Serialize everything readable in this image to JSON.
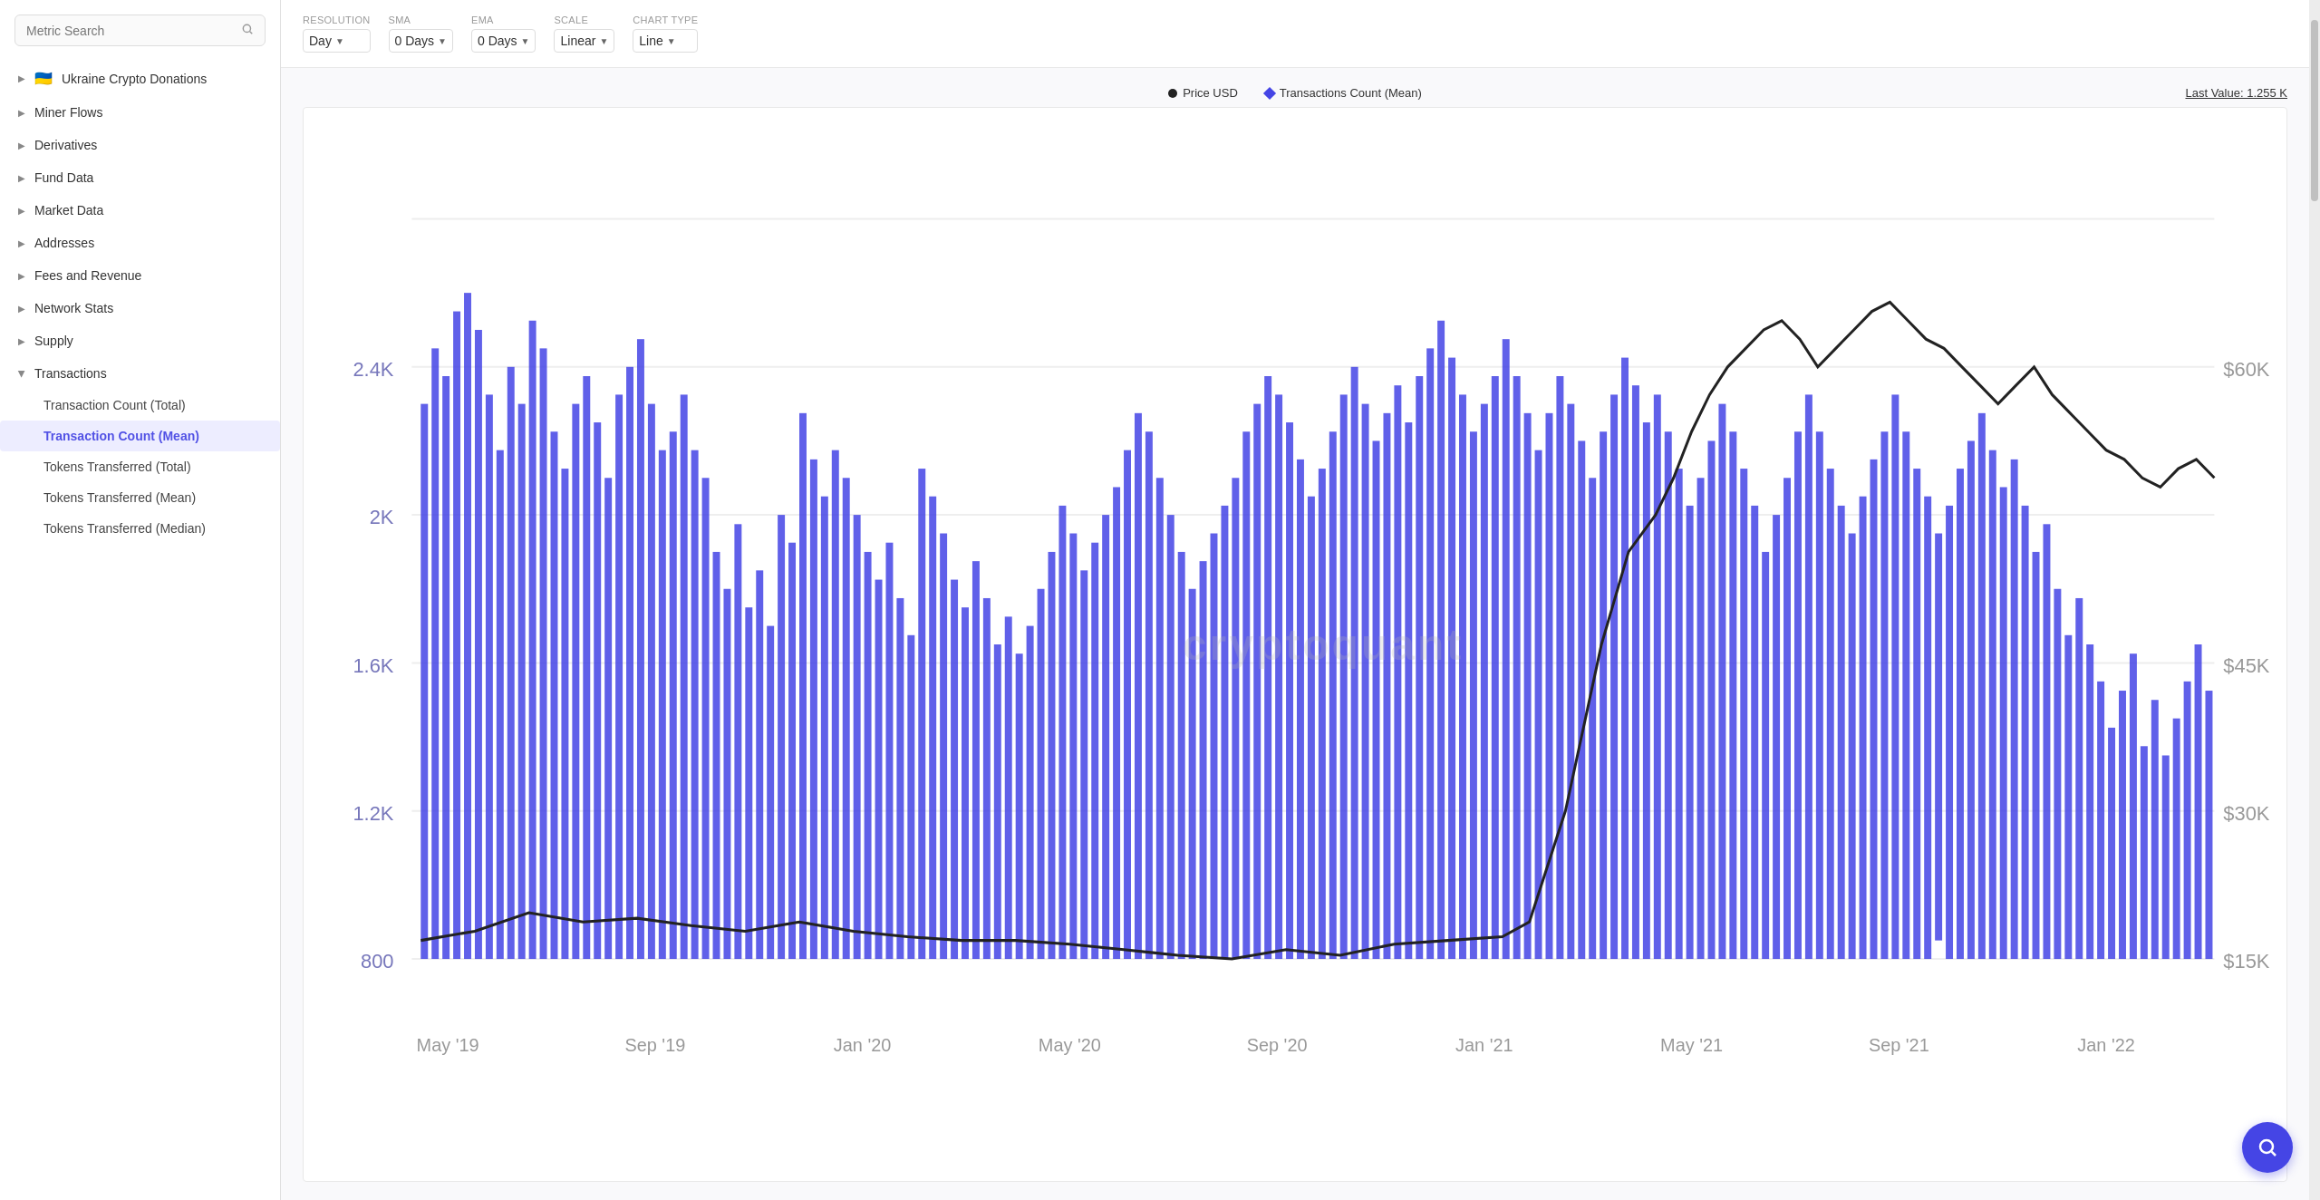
{
  "sidebar": {
    "search_placeholder": "Metric Search",
    "items": [
      {
        "id": "ukraine",
        "label": "Ukraine Crypto Donations",
        "flag": "🇺🇦",
        "expanded": false
      },
      {
        "id": "miner-flows",
        "label": "Miner Flows",
        "expanded": false
      },
      {
        "id": "derivatives",
        "label": "Derivatives",
        "expanded": false
      },
      {
        "id": "fund-data",
        "label": "Fund Data",
        "expanded": false
      },
      {
        "id": "market-data",
        "label": "Market Data",
        "expanded": false
      },
      {
        "id": "addresses",
        "label": "Addresses",
        "expanded": false
      },
      {
        "id": "fees-revenue",
        "label": "Fees and Revenue",
        "expanded": false
      },
      {
        "id": "network-stats",
        "label": "Network Stats",
        "expanded": false
      },
      {
        "id": "supply",
        "label": "Supply",
        "expanded": false
      },
      {
        "id": "transactions",
        "label": "Transactions",
        "expanded": true
      }
    ],
    "sub_items": [
      {
        "id": "tx-count-total",
        "label": "Transaction Count (Total)",
        "active": false
      },
      {
        "id": "tx-count-mean",
        "label": "Transaction Count (Mean)",
        "active": true
      },
      {
        "id": "tokens-total",
        "label": "Tokens Transferred (Total)",
        "active": false
      },
      {
        "id": "tokens-mean",
        "label": "Tokens Transferred (Mean)",
        "active": false
      },
      {
        "id": "tokens-median",
        "label": "Tokens Transferred (Median)",
        "active": false
      }
    ]
  },
  "controls": {
    "resolution_label": "Resolution",
    "resolution_value": "Day",
    "sma_label": "SMA",
    "sma_value": "0 Days",
    "ema_label": "EMA",
    "ema_value": "0 Days",
    "scale_label": "Scale",
    "scale_value": "Linear",
    "chart_type_label": "Chart Type",
    "chart_type_value": "Line"
  },
  "chart": {
    "legend_price": "Price USD",
    "legend_transactions": "Transactions Count (Mean)",
    "last_value_label": "Last Value: 1.255 K",
    "watermark": "cryptoquant",
    "x_labels": [
      "May '19",
      "Sep '19",
      "Jan '20",
      "May '20",
      "Sep '20",
      "Jan '21",
      "May '21",
      "Sep '21",
      "Jan '22"
    ],
    "y_left_labels": [
      "800",
      "1.2K",
      "1.6K",
      "2K",
      "2.4K"
    ],
    "y_right_labels": [
      "$15K",
      "$30K",
      "$45K",
      "$60K"
    ]
  }
}
